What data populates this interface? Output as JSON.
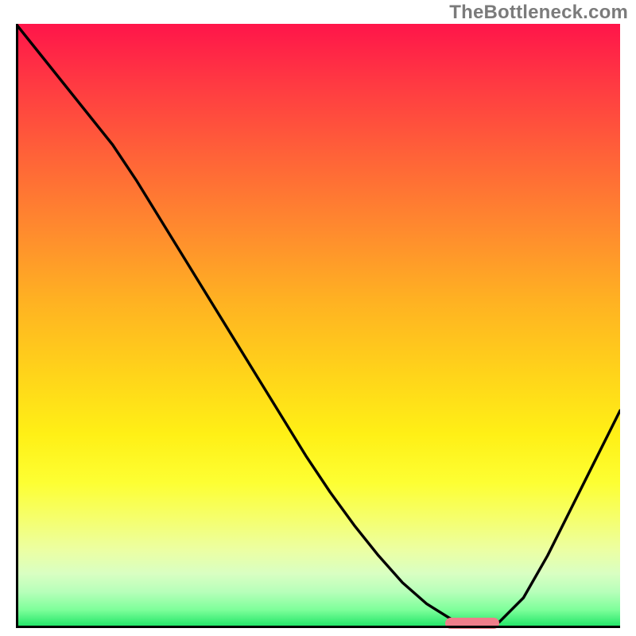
{
  "watermark": "TheBottleneck.com",
  "colors": {
    "curve": "#000000",
    "marker": "#ef7e8a",
    "axis": "#000000"
  },
  "chart_data": {
    "type": "line",
    "title": "",
    "xlabel": "",
    "ylabel": "",
    "xlim": [
      0,
      100
    ],
    "ylim": [
      0,
      100
    ],
    "grid": false,
    "legend": false,
    "series": [
      {
        "name": "curve",
        "x": [
          0,
          4,
          8,
          12,
          16,
          20,
          24,
          28,
          32,
          36,
          40,
          44,
          48,
          52,
          56,
          60,
          64,
          68,
          72,
          74,
          77,
          80,
          84,
          88,
          92,
          96,
          100
        ],
        "y": [
          100,
          95,
          90,
          85,
          80,
          74,
          67.5,
          61,
          54.5,
          48,
          41.5,
          35,
          28.5,
          22.5,
          17,
          12,
          7.5,
          4,
          1.5,
          0.5,
          0.5,
          1,
          5,
          12,
          20,
          28,
          36
        ]
      }
    ],
    "markers": [
      {
        "name": "optimal-range",
        "x_start": 71,
        "x_end": 80,
        "y": 0.6
      }
    ],
    "gradient_stops": [
      {
        "pct": 0,
        "color": "#ff154a"
      },
      {
        "pct": 10,
        "color": "#ff3a42"
      },
      {
        "pct": 22,
        "color": "#ff6338"
      },
      {
        "pct": 34,
        "color": "#ff8a2e"
      },
      {
        "pct": 46,
        "color": "#ffb222"
      },
      {
        "pct": 58,
        "color": "#ffd41a"
      },
      {
        "pct": 68,
        "color": "#fff016"
      },
      {
        "pct": 76,
        "color": "#fdff33"
      },
      {
        "pct": 82,
        "color": "#f5ff6e"
      },
      {
        "pct": 87,
        "color": "#ecffa2"
      },
      {
        "pct": 91,
        "color": "#d9ffc2"
      },
      {
        "pct": 94,
        "color": "#b7ffba"
      },
      {
        "pct": 97,
        "color": "#7dff9a"
      },
      {
        "pct": 100,
        "color": "#18e262"
      }
    ]
  }
}
